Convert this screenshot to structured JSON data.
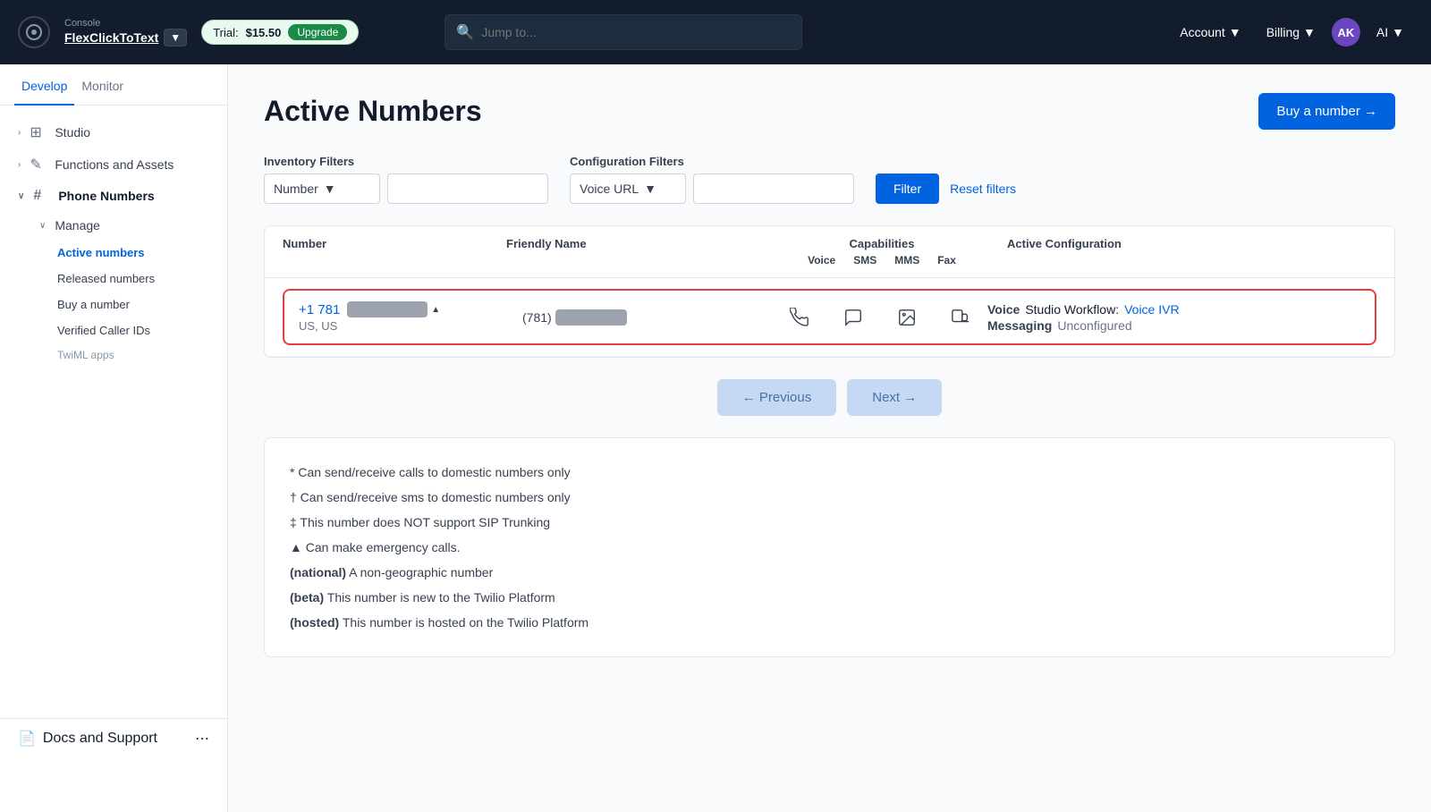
{
  "topnav": {
    "console_label": "Console",
    "app_name": "FlexClickToText",
    "trial_label": "Trial:",
    "trial_amount": "$15.50",
    "upgrade_label": "Upgrade",
    "search_placeholder": "Jump to...",
    "account_label": "Account",
    "billing_label": "Billing",
    "user_initials": "AK",
    "ai_label": "AI"
  },
  "sidebar": {
    "tab_develop": "Develop",
    "tab_monitor": "Monitor",
    "studio_label": "Studio",
    "functions_label": "Functions and Assets",
    "phone_numbers_label": "Phone Numbers",
    "manage_label": "Manage",
    "active_numbers_label": "Active numbers",
    "released_numbers_label": "Released numbers",
    "buy_number_label": "Buy a number",
    "verified_caller_label": "Verified Caller IDs",
    "twiml_apps_label": "TwiML apps",
    "docs_support_label": "Docs and Support",
    "collapse_label": "<<"
  },
  "main": {
    "page_title": "Active Numbers",
    "buy_button_label": "Buy a number →",
    "filters": {
      "inventory_label": "Inventory Filters",
      "number_dropdown": "Number",
      "config_label": "Configuration Filters",
      "voice_url_dropdown": "Voice URL",
      "filter_btn": "Filter",
      "reset_btn": "Reset filters"
    },
    "table": {
      "col_number": "Number",
      "col_friendly": "Friendly Name",
      "col_capabilities": "Capabilities",
      "col_voice": "Voice",
      "col_sms": "SMS",
      "col_mms": "MMS",
      "col_fax": "Fax",
      "col_config": "Active Configuration"
    },
    "row": {
      "number_prefix": "+1 781",
      "number_region": "US, US",
      "friendly_prefix": "(781)",
      "voice_config_label": "Voice",
      "voice_config_type": "Studio Workflow:",
      "voice_config_link": "Voice IVR",
      "messaging_label": "Messaging",
      "messaging_value": "Unconfigured"
    },
    "pagination": {
      "previous_label": "← Previous",
      "next_label": "Next →"
    },
    "legend": {
      "line1": "* Can send/receive calls to domestic numbers only",
      "line2": "† Can send/receive sms to domestic numbers only",
      "line3": "‡ This number does NOT support SIP Trunking",
      "line4": "▲ Can make emergency calls.",
      "line5_bold": "(national)",
      "line5_rest": " A non-geographic number",
      "line6_bold": "(beta)",
      "line6_rest": " This number is new to the Twilio Platform",
      "line7_bold": "(hosted)",
      "line7_rest": " This number is hosted on the Twilio Platform"
    }
  }
}
